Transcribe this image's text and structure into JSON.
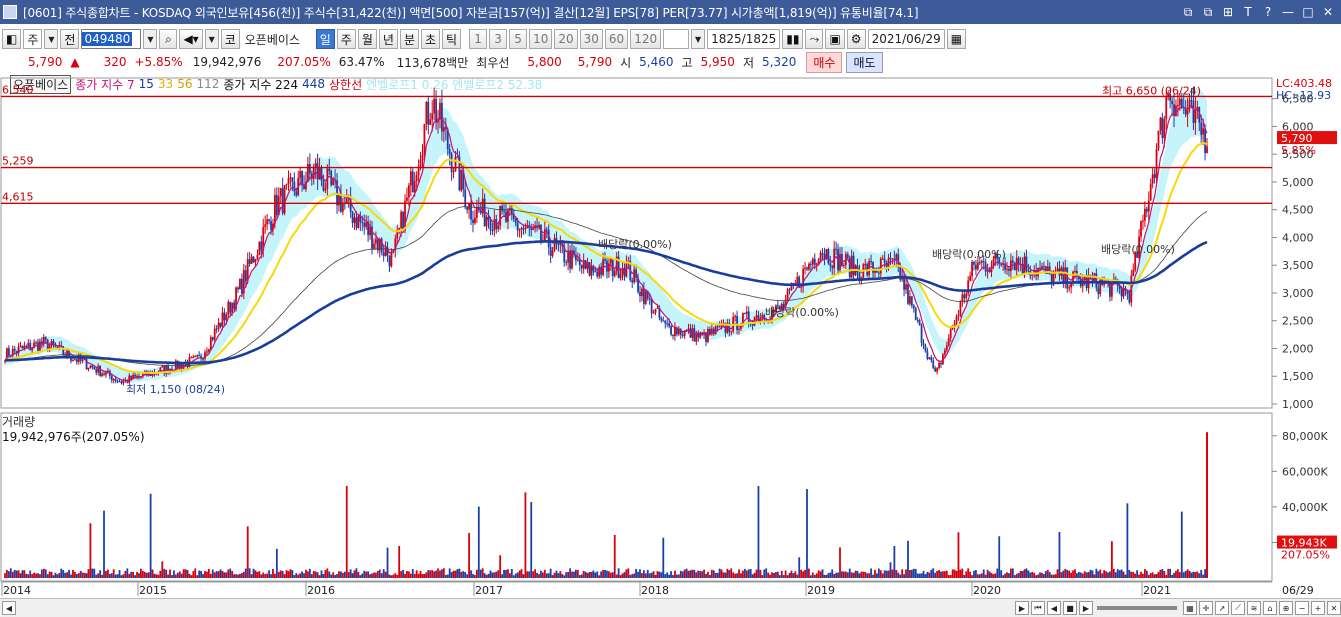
{
  "window": {
    "title": "[0601] 주식종합차트 - KOSDAQ 외국인보유[456(천)] 주식수[31,422(천)] 액면[500] 자본금[157(억)] 결산[12월] EPS[78] PER[73.77] 시가총액[1,819(억)] 유통비율[74.1]",
    "controls": [
      "⧉",
      "⧉",
      "⊞",
      "T",
      "?",
      "—",
      "□",
      "✕"
    ]
  },
  "toolbar": {
    "layout_btn": "◧",
    "period_type": "주",
    "prev": "전",
    "code": "049480",
    "market_btn": "코",
    "name": "오픈베이스",
    "tabs": [
      "일",
      "주",
      "월",
      "년",
      "분",
      "초",
      "틱"
    ],
    "selected_tab": "일",
    "intervals": [
      "1",
      "3",
      "5",
      "10",
      "20",
      "30",
      "60",
      "120"
    ],
    "count": "1825/1825",
    "date": "2021/06/29"
  },
  "quote": {
    "price": "5,790",
    "arrow": "▲",
    "change": "320",
    "change_pct": "+5.85%",
    "volume": "19,942,976",
    "vol_ratio": "207.05%",
    "turnover": "63.47%",
    "amount": "113,678백만",
    "best_ask_label": "최우선",
    "best_ask": "5,800",
    "best_bid": "5,790",
    "open_label": "시",
    "open": "5,460",
    "high_label": "고",
    "high": "5,950",
    "low_label": "저",
    "low": "5,320",
    "buy": "매수",
    "sell": "매도"
  },
  "legend": {
    "name": "오픈베이스",
    "ma_label1": "종가 지수 7",
    "ma15": "15",
    "ma33": "33",
    "ma56": "56",
    "ma112": "112",
    "ma_label2": "종가 지수 224",
    "ma448": "448",
    "limit": "상한선",
    "extra": "엔벨로프1 0.26  엔벨로프2 52.38"
  },
  "price_axis": {
    "ticks": [
      "6,500",
      "6,000",
      "5,500",
      "5,000",
      "4,500",
      "4,000",
      "3,500",
      "3,000",
      "2,500",
      "2,000",
      "1,500",
      "1,000"
    ],
    "lc": "LC:403.48",
    "hc": "HC:-12.93",
    "current": "5,790",
    "current_pct": "5.85%"
  },
  "hlines": [
    {
      "label": "6,540",
      "value": 6540
    },
    {
      "label": "5,259",
      "value": 5259
    },
    {
      "label": "4,615",
      "value": 4615
    }
  ],
  "annotations": {
    "high": "최고 6,650 (06/24)",
    "low": "최저 1,150 (08/24)",
    "div1": "배당락(0.00%)",
    "div2": "배당락(0.00%)",
    "div3": "배당락(0.00%)",
    "div4": "배당락(0.00%)"
  },
  "volume": {
    "title": "거래량",
    "current": "19,942,976주(207.05%)",
    "ticks": [
      "80,000K",
      "60,000K",
      "40,000K",
      "20,000K"
    ],
    "current_badge": "19,943K",
    "current_pct": "207.05%"
  },
  "time_axis": {
    "years": [
      "2014",
      "2015",
      "2016",
      "2017",
      "2018",
      "2019",
      "2020",
      "2021"
    ],
    "last": "06/29"
  },
  "colors": {
    "title_bg": "#3d5a99",
    "candle_up": "#d8000c",
    "candle_down": "#1b3fa6",
    "ma_long": "#1a3d9c",
    "ma_mid": "#f5d90a",
    "envelope": "#bff4fb",
    "hline": "#d00000"
  },
  "chart_data": {
    "type": "line",
    "title": "",
    "xlabel": "",
    "ylabel": "",
    "x": [
      "2014-01",
      "2014-04",
      "2014-08",
      "2014-12",
      "2015-04",
      "2015-08",
      "2015-12",
      "2016-03",
      "2016-06",
      "2016-09",
      "2016-12",
      "2017-02",
      "2017-05",
      "2017-08",
      "2017-11",
      "2018-02",
      "2018-05",
      "2018-08",
      "2018-11",
      "2019-02",
      "2019-05",
      "2019-08",
      "2019-11",
      "2020-02",
      "2020-03",
      "2020-06",
      "2020-09",
      "2020-12",
      "2021-03",
      "2021-05",
      "2021-06-24",
      "2021-06-29"
    ],
    "series": [
      {
        "values": [
          1900,
          2100,
          1750,
          1400,
          1600,
          1800,
          3000,
          4600,
          5200,
          4400,
          3600,
          6500,
          4500,
          4300,
          3900,
          3400,
          3500,
          2400,
          2200,
          2500,
          2700,
          3800,
          3400,
          3500,
          1500,
          3500,
          3600,
          3300,
          3200,
          3000,
          6650,
          5790
        ]
      }
    ],
    "ylim": [
      1000,
      6800
    ],
    "ticks": [
      "6,500",
      "6,000",
      "5,500",
      "5,000",
      "4,500",
      "4,000",
      "3,500",
      "3,000",
      "2,500",
      "2,000",
      "1,500",
      "1,000"
    ],
    "volume_ylim": [
      0,
      90000
    ],
    "volume_unit": "K",
    "current_volume": 19943
  }
}
